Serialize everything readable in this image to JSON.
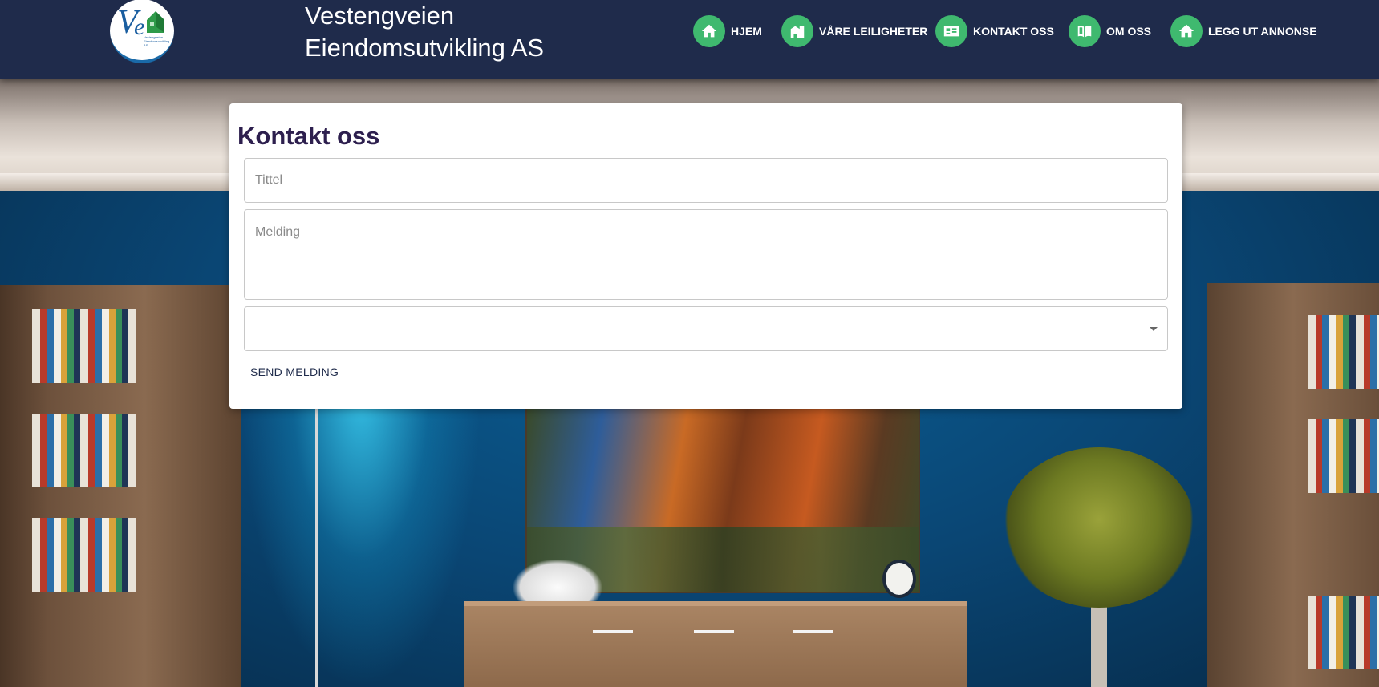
{
  "header": {
    "logo_alt": "Ve",
    "logo_caption": "Vestengveien Eiendomsutvikling AS",
    "site_title": "Vestengveien Eiendomsutvikling AS",
    "nav": [
      {
        "label": "HJEM",
        "icon": "home-icon"
      },
      {
        "label": "VÅRE LEILIGHETER",
        "icon": "apartment-building-icon"
      },
      {
        "label": "KONTAKT OSS",
        "icon": "contact-card-icon"
      },
      {
        "label": "OM OSS",
        "icon": "book-icon"
      },
      {
        "label": "LEGG UT ANNONSE",
        "icon": "home-icon"
      }
    ]
  },
  "form": {
    "heading": "Kontakt oss",
    "title_field": {
      "placeholder": "Tittel",
      "value": ""
    },
    "message_field": {
      "placeholder": "Melding",
      "value": ""
    },
    "select": {
      "value": ""
    },
    "submit_label": "SEND MELDING"
  },
  "colors": {
    "header_bg": "#1f2b4b",
    "nav_icon_bg": "#3fb96f",
    "heading_text": "#2d1f4e"
  }
}
